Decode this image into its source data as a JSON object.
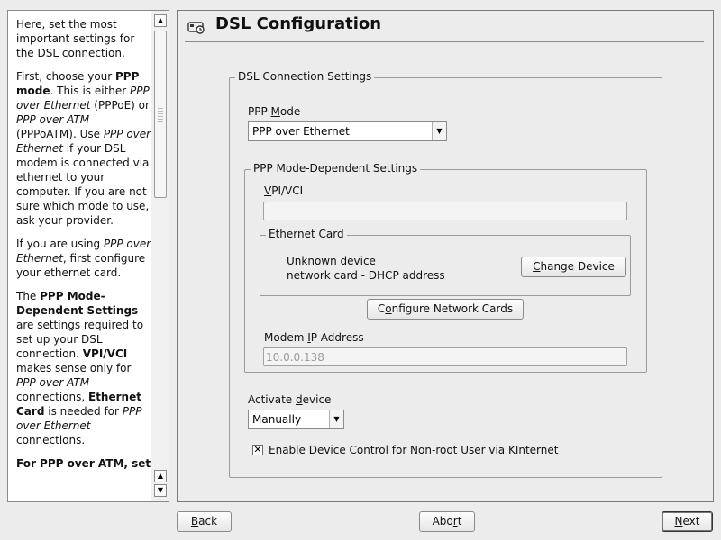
{
  "help": {
    "p1": "Here, set the most important settings for the DSL connection.",
    "p2_a": "First, choose your ",
    "p2_b": "PPP mode",
    "p2_c": ". This is either ",
    "p2_d": "PPP over Ethernet",
    "p2_e": " (PPPoE) or ",
    "p2_f": "PPP over ATM",
    "p2_g": " (PPPoATM). Use ",
    "p2_h": "PPP over Ethernet",
    "p2_i": " if your DSL modem is connected via ethernet to your computer. If you are not sure which mode to use, ask your provider.",
    "p3_a": "If you are using ",
    "p3_b": "PPP over Ethernet",
    "p3_c": ", first configure your ethernet card.",
    "p4_a": "The ",
    "p4_b": "PPP Mode-Dependent Settings",
    "p4_c": " are settings required to set up your DSL connection. ",
    "p4_d": "VPI/VCI",
    "p4_e": " makes sense only for ",
    "p4_f": "PPP over ATM",
    "p4_g": " connections, ",
    "p4_h": "Ethernet Card",
    "p4_i": " is needed for ",
    "p4_j": "PPP over Ethernet",
    "p4_k": " connections.",
    "p5": "For PPP over ATM, set"
  },
  "title": "DSL Configuration",
  "dsl_group": {
    "title": "DSL Connection Settings"
  },
  "ppp_mode": {
    "label_u": "M",
    "label_pre": "PPP ",
    "label_post": "ode",
    "value": "PPP over Ethernet"
  },
  "dependent_group": {
    "title": "PPP Mode-Dependent Settings"
  },
  "vpi": {
    "label_u": "V",
    "label_rest": "PI/VCI",
    "value": ""
  },
  "ethernet_group": {
    "title": "Ethernet Card",
    "line1": "Unknown device",
    "line2": "network card - DHCP address",
    "change_u": "C",
    "change_rest": "hange Device"
  },
  "configure_button": {
    "pre": "C",
    "u": "o",
    "post": "nfigure Network Cards"
  },
  "modem_ip": {
    "label_pre": "Modem ",
    "label_u": "I",
    "label_post": "P Address",
    "value": "10.0.0.138"
  },
  "activate": {
    "label_pre": "Activate ",
    "label_u": "d",
    "label_post": "evice",
    "value": "Manually"
  },
  "nonroot": {
    "u": "E",
    "rest": "nable Device Control for Non-root User via KInternet",
    "checked": "✕"
  },
  "buttons": {
    "back_u": "B",
    "back_rest": "ack",
    "abort_pre": "Abo",
    "abort_u": "r",
    "abort_post": "t",
    "next_u": "N",
    "next_rest": "ext"
  }
}
